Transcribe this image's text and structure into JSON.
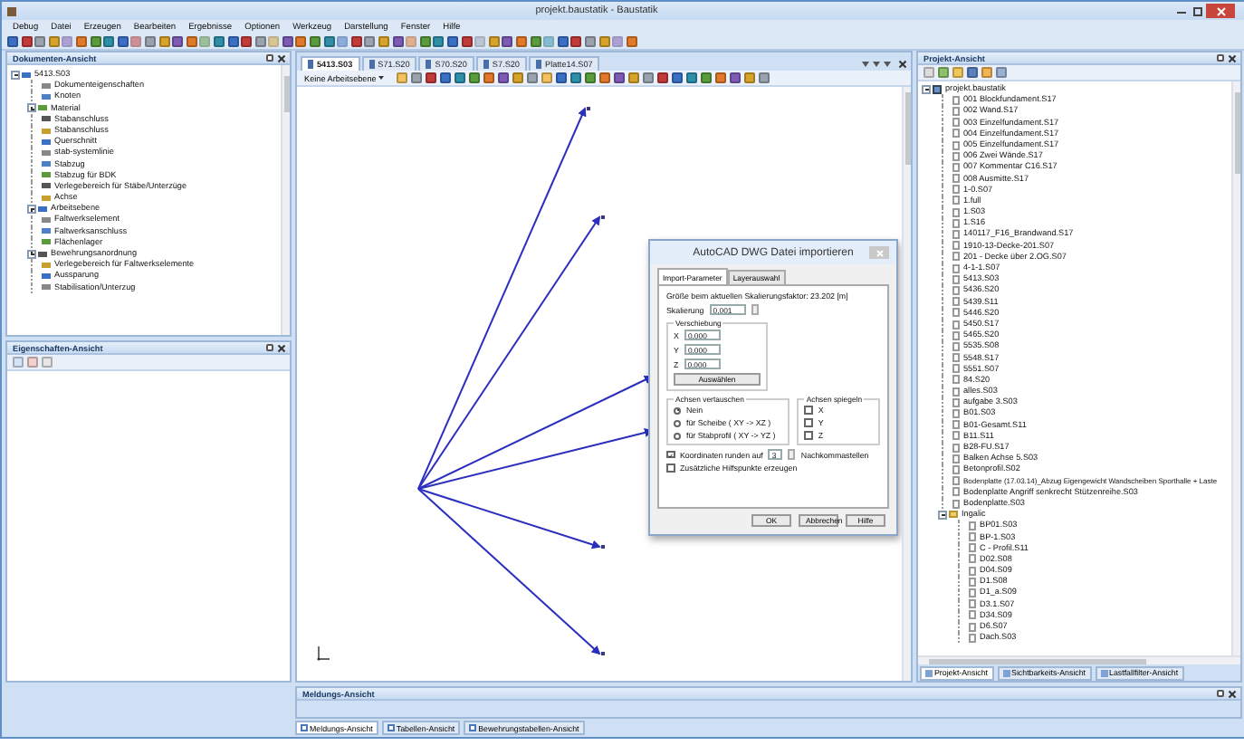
{
  "window": {
    "title": "projekt.baustatik - Baustatik"
  },
  "menu": [
    "Debug",
    "Datei",
    "Erzeugen",
    "Bearbeiten",
    "Ergebnisse",
    "Optionen",
    "Werkzeug",
    "Darstellung",
    "Fenster",
    "Hilfe"
  ],
  "document_view": {
    "title": "Dokumenten-Ansicht",
    "tree": [
      {
        "label": "5413.S03",
        "expanded": true,
        "children": [
          {
            "label": "Dokumenteigenschaften"
          },
          {
            "label": "Knoten"
          },
          {
            "label": "Material",
            "expanded": false
          },
          {
            "label": "Stabanschluss"
          },
          {
            "label": "Stabanschluss"
          },
          {
            "label": "Querschnitt"
          },
          {
            "label": "stab-systemlinie"
          },
          {
            "label": "Stabzug"
          },
          {
            "label": "Stabzug für BDK"
          },
          {
            "label": "Verlegebereich für Stäbe/Unterzüge"
          },
          {
            "label": "Achse"
          },
          {
            "label": "Arbeitsebene",
            "expanded": false
          },
          {
            "label": "Faltwerkselement"
          },
          {
            "label": "Faltwerksanschluss"
          },
          {
            "label": "Flächenlager"
          },
          {
            "label": "Bewehrungsanordnung",
            "expanded": false
          },
          {
            "label": "Verlegebereich für Faltwerkselemente"
          },
          {
            "label": "Aussparung"
          },
          {
            "label": "Stabilisation/Unterzug"
          }
        ]
      }
    ]
  },
  "properties_view": {
    "title": "Eigenschaften-Ansicht"
  },
  "editor_tabs": [
    {
      "label": "5413.S03",
      "selected": true
    },
    {
      "label": "S71.S20",
      "selected": false
    },
    {
      "label": "S70.S20",
      "selected": false
    },
    {
      "label": "S7.S20",
      "selected": false
    },
    {
      "label": "Platte14.S07",
      "selected": false
    }
  ],
  "workplane": {
    "value": "Keine Arbeitsebene"
  },
  "dialog": {
    "title": "AutoCAD DWG Datei importieren",
    "tabs": [
      {
        "label": "Import-Parameter",
        "selected": true
      },
      {
        "label": "Layerauswahl",
        "selected": false
      }
    ],
    "size_info": "Größe beim aktuellen Skalierungsfaktor: 23.202 [m]",
    "scale": {
      "label": "Skalierung",
      "value": "0.001"
    },
    "offset": {
      "title": "Verschiebung",
      "fields": [
        {
          "label": "X",
          "value": "0.000"
        },
        {
          "label": "Y",
          "value": "0.000"
        },
        {
          "label": "Z",
          "value": "0.000"
        }
      ],
      "button": "Auswählen"
    },
    "swap_axes": {
      "title": "Achsen vertauschen",
      "options": [
        {
          "label": "Nein",
          "selected": true
        },
        {
          "label": "für Scheibe ( XY -> XZ )",
          "selected": false
        },
        {
          "label": "für Stabprofil ( XY -> YZ )",
          "selected": false
        }
      ]
    },
    "mirror_axes": {
      "title": "Achsen spiegeln",
      "options": [
        {
          "label": "X",
          "checked": false
        },
        {
          "label": "Y",
          "checked": false
        },
        {
          "label": "Z",
          "checked": false
        }
      ]
    },
    "round": {
      "label": "Koordinaten runden auf",
      "checked": true,
      "value": "3",
      "unit": "Nachkommastellen"
    },
    "helper_points": {
      "label": "Zusätzliche Hilfspunkte erzeugen",
      "checked": false
    },
    "buttons": [
      "OK",
      "Abbrechen",
      "Hilfe"
    ]
  },
  "project_view": {
    "title": "Projekt-Ansicht",
    "tree": [
      {
        "label": "projekt.baustatik",
        "kind": "project",
        "expanded": true,
        "children": [
          {
            "label": "001 Blockfundament.S17",
            "kind": "file"
          },
          {
            "label": "002 Wand.S17",
            "kind": "file"
          },
          {
            "label": "003 Einzelfundament.S17",
            "kind": "file"
          },
          {
            "label": "004 Einzelfundament.S17",
            "kind": "file"
          },
          {
            "label": "005 Einzelfundament.S17",
            "kind": "file"
          },
          {
            "label": "006 Zwei Wände.S17",
            "kind": "file"
          },
          {
            "label": "007 Kommentar C16.S17",
            "kind": "file"
          },
          {
            "label": "008 Ausmitte.S17",
            "kind": "file"
          },
          {
            "label": "1-0.S07",
            "kind": "file"
          },
          {
            "label": "1.full",
            "kind": "file"
          },
          {
            "label": "1.S03",
            "kind": "file"
          },
          {
            "label": "1.S16",
            "kind": "file"
          },
          {
            "label": "140117_F16_Brandwand.S17",
            "kind": "file"
          },
          {
            "label": "1910-13-Decke-201.S07",
            "kind": "file"
          },
          {
            "label": "201 - Decke über 2.OG.S07",
            "kind": "file"
          },
          {
            "label": "4-1-1.S07",
            "kind": "file"
          },
          {
            "label": "5413.S03",
            "kind": "file"
          },
          {
            "label": "5436.S20",
            "kind": "file"
          },
          {
            "label": "5439.S11",
            "kind": "file"
          },
          {
            "label": "5446.S20",
            "kind": "file"
          },
          {
            "label": "5450.S17",
            "kind": "file"
          },
          {
            "label": "5465.S20",
            "kind": "file"
          },
          {
            "label": "5535.S08",
            "kind": "file"
          },
          {
            "label": "5548.S17",
            "kind": "file"
          },
          {
            "label": "5551.S07",
            "kind": "file"
          },
          {
            "label": "84.S20",
            "kind": "file"
          },
          {
            "label": "alles.S03",
            "kind": "file"
          },
          {
            "label": "aufgabe 3.S03",
            "kind": "file"
          },
          {
            "label": "B01.S03",
            "kind": "file"
          },
          {
            "label": "B01-Gesamt.S11",
            "kind": "file"
          },
          {
            "label": "B11.S11",
            "kind": "file"
          },
          {
            "label": "B28-FU.S17",
            "kind": "file"
          },
          {
            "label": "Balken Achse 5.S03",
            "kind": "file"
          },
          {
            "label": "Betonprofil.S02",
            "kind": "file"
          },
          {
            "label": "Bodenplatte (17.03.14)_Abzug Eigengewicht Wandscheiben Sporthalle + Laste",
            "kind": "file"
          },
          {
            "label": "Bodenplatte Angriff senkrecht Stützenreihe.S03",
            "kind": "file"
          },
          {
            "label": "Bodenplatte.S03",
            "kind": "file"
          },
          {
            "label": "Ingalic",
            "kind": "folder",
            "expanded": true,
            "children": [
              {
                "label": "BP01.S03",
                "kind": "file"
              },
              {
                "label": "BP-1.S03",
                "kind": "file"
              },
              {
                "label": "C - Profil.S11",
                "kind": "file"
              },
              {
                "label": "D02.S08",
                "kind": "file"
              },
              {
                "label": "D04.S09",
                "kind": "file"
              },
              {
                "label": "D1.S08",
                "kind": "file"
              },
              {
                "label": "D1_a.S09",
                "kind": "file"
              },
              {
                "label": "D3.1.S07",
                "kind": "file"
              },
              {
                "label": "D34.S09",
                "kind": "file"
              },
              {
                "label": "D6.S07",
                "kind": "file"
              },
              {
                "label": "Dach.S03",
                "kind": "file"
              }
            ]
          }
        ]
      }
    ],
    "tabs": [
      {
        "label": "Projekt-Ansicht",
        "selected": true
      },
      {
        "label": "Sichtbarkeits-Ansicht",
        "selected": false
      },
      {
        "label": "Lastfallfilter-Ansicht",
        "selected": false
      }
    ]
  },
  "message_view": {
    "title": "Meldungs-Ansicht"
  },
  "bottom_tabs": [
    {
      "label": "Meldungs-Ansicht",
      "selected": true
    },
    {
      "label": "Tabellen-Ansicht",
      "selected": false
    },
    {
      "label": "Bewehrungstabellen-Ansicht",
      "selected": false
    }
  ]
}
